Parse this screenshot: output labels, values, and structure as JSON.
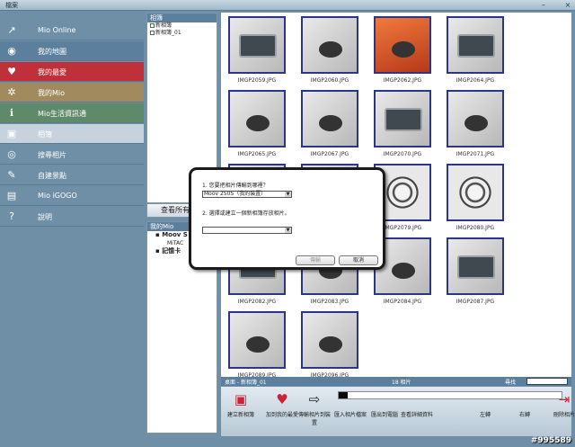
{
  "window": {
    "title": "檔案"
  },
  "sidebar": {
    "items": [
      {
        "label": "Mio Online",
        "icon": "mio-online-icon",
        "glyph": "↗",
        "bg": "#6f8fa7"
      },
      {
        "label": "我的地圖",
        "icon": "eye-icon",
        "glyph": "◉",
        "bg": "#5b7f9c"
      },
      {
        "label": "我的最愛",
        "icon": "heart-icon",
        "glyph": "♥",
        "bg": "#c0303a"
      },
      {
        "label": "我的Mio",
        "icon": "gear-icon",
        "glyph": "✲",
        "bg": "#a08a5e"
      },
      {
        "label": "Mio生活資訊通",
        "icon": "info-icon",
        "glyph": "ℹ",
        "bg": "#5f8a6a"
      },
      {
        "label": "相簿",
        "icon": "photo-album-icon",
        "glyph": "▣",
        "bg": "#c6d3dd"
      },
      {
        "label": "搜尋相片",
        "icon": "camera-icon",
        "glyph": "◎",
        "bg": "#6f8fa7"
      },
      {
        "label": "自建景點",
        "icon": "poi-icon",
        "glyph": "✎",
        "bg": "#6f8fa7"
      },
      {
        "label": "Mio iGOGO",
        "icon": "book-icon",
        "glyph": "▤",
        "bg": "#6f8fa7"
      },
      {
        "label": "說明",
        "icon": "help-icon",
        "glyph": "?",
        "bg": "#6f8fa7"
      }
    ]
  },
  "tree": {
    "header": "相簿",
    "items": [
      "新相簿",
      "新相簿_01"
    ]
  },
  "view_all_button": "查看所有",
  "device": {
    "header": "我的Mio",
    "items": [
      "Moov S",
      "MiTAC",
      "記憶卡"
    ]
  },
  "photos": [
    {
      "name": "IMGP2059.JPG",
      "style": "p-gray"
    },
    {
      "name": "IMGP2060.JPG",
      "style": "p-gray"
    },
    {
      "name": "IMGP2062.JPG",
      "style": "p-orange"
    },
    {
      "name": "IMGP2064.JPG",
      "style": "p-gray"
    },
    {
      "name": "IMGP2065.JPG",
      "style": "p-gray"
    },
    {
      "name": "IMGP2067.JPG",
      "style": "p-gray"
    },
    {
      "name": "IMGP2070.JPG",
      "style": "p-gray"
    },
    {
      "name": "IMGP2071.JPG",
      "style": "p-gray"
    },
    {
      "name": "",
      "style": "p-gray"
    },
    {
      "name": "",
      "style": "p-gray"
    },
    {
      "name": "IMGP2079.JPG",
      "style": "p-cable"
    },
    {
      "name": "IMGP2080.JPG",
      "style": "p-cable"
    },
    {
      "name": "IMGP2082.JPG",
      "style": "p-gray"
    },
    {
      "name": "IMGP2083.JPG",
      "style": "p-gray"
    },
    {
      "name": "IMGP2084.JPG",
      "style": "p-gray"
    },
    {
      "name": "IMGP2087.JPG",
      "style": "p-gray"
    },
    {
      "name": "IMGP2089.JPG",
      "style": "p-gray"
    },
    {
      "name": "IMGP2096.JPG",
      "style": "p-gray"
    }
  ],
  "status": {
    "path": "桌面 - 新相簿_01",
    "count": "18 相片",
    "search_label": "尋找"
  },
  "toolbar": {
    "progress": 0.04,
    "buttons": [
      {
        "label": "建立新相簿",
        "icon": "new-album-icon",
        "glyph": "▣",
        "color": "#c23"
      },
      {
        "label": "加到我的最愛",
        "icon": "add-favorite-icon",
        "glyph": "♥",
        "color": "#c23"
      },
      {
        "label": "傳輸相片到裝置",
        "icon": "transfer-icon",
        "glyph": "⇨",
        "color": "#222"
      },
      {
        "label": "匯入相片檔案",
        "icon": "import-icon",
        "glyph": "",
        "color": "#222"
      },
      {
        "label": "匯出到電腦",
        "icon": "export-icon",
        "glyph": "",
        "color": "#222"
      },
      {
        "label": "查看詳細資料",
        "icon": "details-icon",
        "glyph": "",
        "color": "#222"
      },
      {
        "label": "左轉",
        "icon": "rotate-left-icon",
        "glyph": "",
        "color": "#222"
      },
      {
        "label": "右轉",
        "icon": "rotate-right-icon",
        "glyph": "",
        "color": "#222"
      },
      {
        "label": "刪除相片",
        "icon": "delete-photo-icon",
        "glyph": "⇥",
        "color": "#c23"
      }
    ]
  },
  "dialog": {
    "q1": "1. 您要把相片傳輸到哪裡？",
    "device_value": "Moov 250S（我的裝置）",
    "q2": "2. 選擇或建立一個新相簿存放相片。",
    "album_value": "",
    "ok_label": "傳輸",
    "cancel_label": "取消"
  },
  "watermark": "#995589"
}
